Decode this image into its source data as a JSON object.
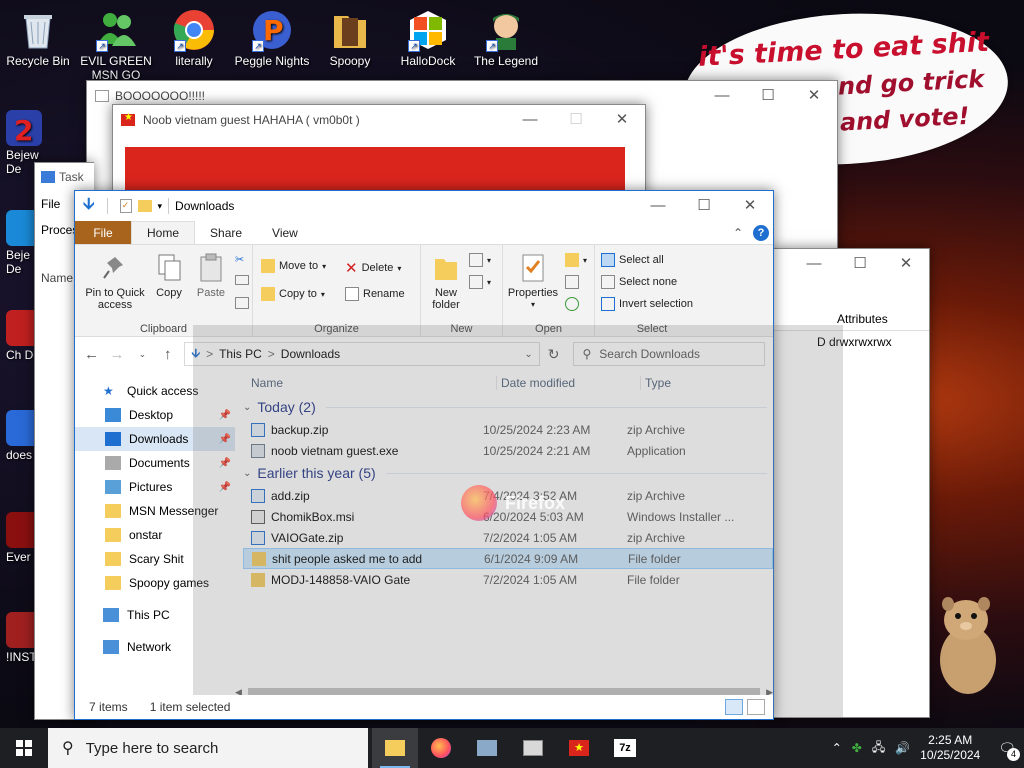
{
  "desktop": {
    "top_icons": [
      {
        "label": "Recycle Bin",
        "icon": "recycle-bin-icon"
      },
      {
        "label": "EVIL GREEN MSN GO",
        "icon": "msn-icon"
      },
      {
        "label": "literally",
        "icon": "chrome-icon"
      },
      {
        "label": "Peggle Nights",
        "icon": "peggle-icon"
      },
      {
        "label": "Spoopy",
        "icon": "folder-icon"
      },
      {
        "label": "HalloDock",
        "icon": "windows-icon"
      },
      {
        "label": "The Legend",
        "icon": "legend-icon"
      }
    ],
    "left_icons": [
      {
        "label": "Bejew De",
        "icon": "bejeweled-icon"
      },
      {
        "label": "Beje De",
        "icon": "bejeweled2-icon"
      },
      {
        "label": "Ch De",
        "icon": "chrome-icon"
      },
      {
        "label": "does",
        "icon": "app-icon"
      },
      {
        "label": "Ever",
        "icon": "app-icon"
      },
      {
        "label": "!INST",
        "icon": "app-icon"
      }
    ],
    "bubble": {
      "line1": "it's time to eat shit",
      "line2": "nd go trick",
      "line3": "and vote!"
    }
  },
  "windows": {
    "boo": {
      "title": "BOOOOOOO!!!!!"
    },
    "noob": {
      "title": "Noob vietnam guest HAHAHA ( vm0b0t )"
    },
    "task": {
      "title": "Task",
      "file_tab": "File",
      "proc_tab": "Proces",
      "name_col": "Name"
    },
    "attrib": {
      "col": "Attributes",
      "value": "D drwxrwxrwx"
    }
  },
  "explorer": {
    "title": "Downloads",
    "tabs": [
      "File",
      "Home",
      "Share",
      "View"
    ],
    "ribbon": {
      "clipboard": {
        "label": "Clipboard",
        "pin": "Pin to Quick access",
        "copy": "Copy",
        "paste": "Paste"
      },
      "organize": {
        "label": "Organize",
        "move_to": "Move to",
        "copy_to": "Copy to",
        "delete": "Delete",
        "rename": "Rename"
      },
      "new": {
        "label": "New",
        "new_folder": "New folder"
      },
      "open": {
        "label": "Open",
        "properties": "Properties"
      },
      "select": {
        "label": "Select",
        "select_all": "Select all",
        "select_none": "Select none",
        "invert": "Invert selection"
      }
    },
    "address": {
      "this_pc": "This PC",
      "sep": ">",
      "downloads": "Downloads"
    },
    "search_placeholder": "Search Downloads",
    "nav": [
      {
        "label": "Quick access",
        "icon": "star-icon",
        "pinned": false,
        "level": 0
      },
      {
        "label": "Desktop",
        "icon": "desktop-icon",
        "pinned": true,
        "level": 1
      },
      {
        "label": "Downloads",
        "icon": "download-icon",
        "pinned": true,
        "level": 1,
        "selected": true
      },
      {
        "label": "Documents",
        "icon": "documents-icon",
        "pinned": true,
        "level": 1
      },
      {
        "label": "Pictures",
        "icon": "pictures-icon",
        "pinned": true,
        "level": 1
      },
      {
        "label": "MSN Messenger",
        "icon": "folder-icon",
        "pinned": false,
        "level": 1
      },
      {
        "label": "onstar",
        "icon": "folder-icon",
        "pinned": false,
        "level": 1
      },
      {
        "label": "Scary Shit",
        "icon": "folder-icon",
        "pinned": false,
        "level": 1
      },
      {
        "label": "Spoopy games",
        "icon": "folder-icon",
        "pinned": false,
        "level": 1
      },
      {
        "label": "This PC",
        "icon": "pc-icon",
        "pinned": false,
        "level": 0
      },
      {
        "label": "Network",
        "icon": "network-icon",
        "pinned": false,
        "level": 0
      }
    ],
    "columns": {
      "name": "Name",
      "date": "Date modified",
      "type": "Type"
    },
    "groups": [
      {
        "label": "Today (2)",
        "files": [
          {
            "name": "backup.zip",
            "date": "10/25/2024 2:23 AM",
            "type": "zip Archive",
            "icon": "zip-icon"
          },
          {
            "name": "noob vietnam guest.exe",
            "date": "10/25/2024 2:21 AM",
            "type": "Application",
            "icon": "exe-icon"
          }
        ]
      },
      {
        "label": "Earlier this year (5)",
        "files": [
          {
            "name": "add.zip",
            "date": "7/4/2024 3:52 AM",
            "type": "zip Archive",
            "icon": "zip-icon"
          },
          {
            "name": "ChomikBox.msi",
            "date": "6/20/2024 5:03 AM",
            "type": "Windows Installer ...",
            "icon": "msi-icon"
          },
          {
            "name": "VAIOGate.zip",
            "date": "7/2/2024 1:05 AM",
            "type": "zip Archive",
            "icon": "zip-icon"
          },
          {
            "name": "shit people asked me to add",
            "date": "6/1/2024 9:09 AM",
            "type": "File folder",
            "icon": "folder-icon",
            "selected": true
          },
          {
            "name": "MODJ-148858-VAIO Gate",
            "date": "7/2/2024 1:05 AM",
            "type": "File folder",
            "icon": "folder-icon"
          }
        ]
      }
    ],
    "ghost_label": "Firefox",
    "status": {
      "items": "7 items",
      "selected": "1 item selected"
    }
  },
  "taskbar": {
    "search_placeholder": "Type here to search",
    "time": "2:25 AM",
    "date": "10/25/2024",
    "notifications": "4"
  },
  "colors": {
    "accent": "#1f6fd0",
    "file_tab": "#a8641c",
    "selection": "#cce8ff",
    "bubble_text": "#c8102e"
  }
}
